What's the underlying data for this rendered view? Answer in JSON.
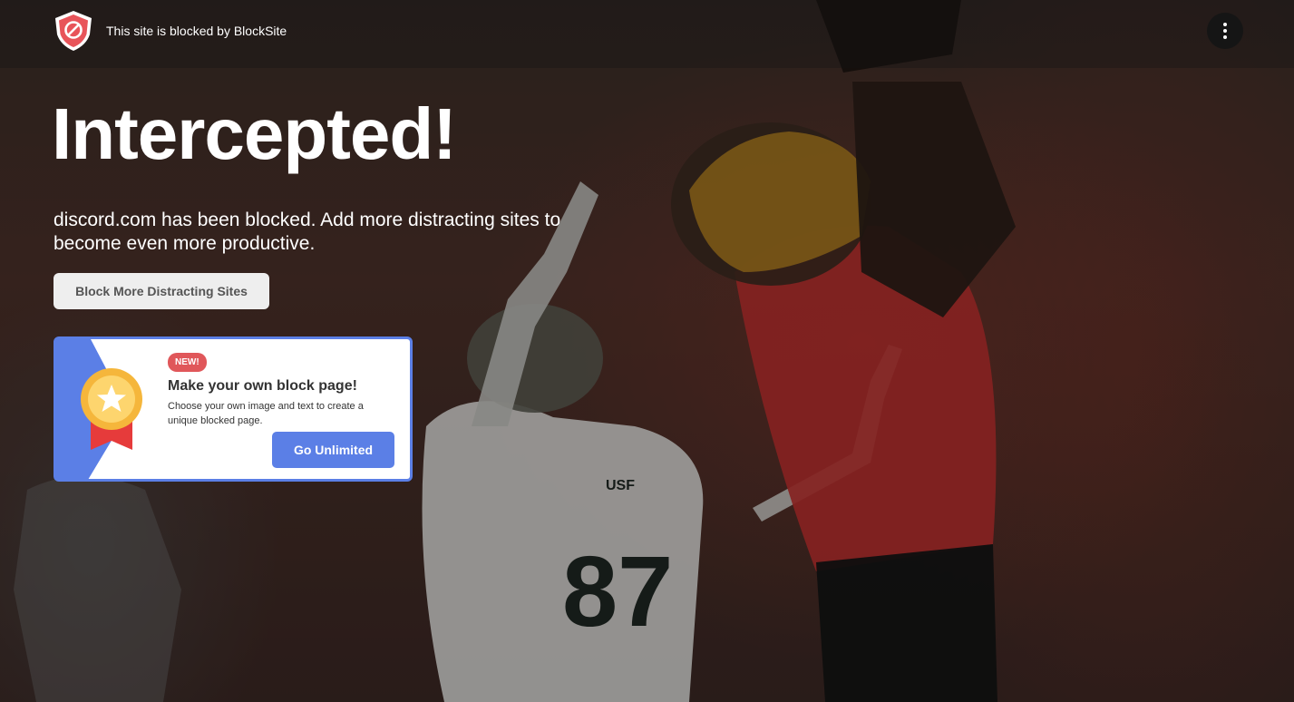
{
  "header": {
    "brand_text": "This site is blocked by BlockSite"
  },
  "main": {
    "headline": "Intercepted!",
    "message": "discord.com has been blocked. Add more distracting sites to become even more productive.",
    "block_more_label": "Block More Distracting Sites"
  },
  "promo": {
    "badge": "NEW!",
    "title": "Make your own block page!",
    "description": "Choose your own image and text to create a unique blocked page.",
    "cta_label": "Go Unlimited"
  },
  "background": {
    "jersey_number": "87",
    "jersey_logo": "USF"
  },
  "colors": {
    "accent_blue": "#5b7fe6",
    "badge_red": "#e0575a",
    "shield_red": "#e8545a"
  }
}
